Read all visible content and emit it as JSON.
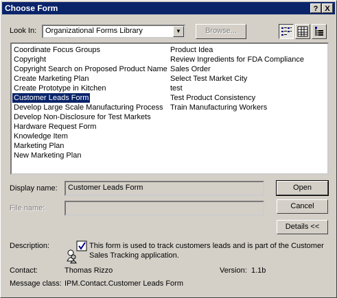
{
  "window": {
    "title": "Choose Form",
    "help_btn": "?",
    "close_btn": "X"
  },
  "lookin": {
    "label": "Look In:",
    "value": "Organizational Forms Library",
    "browse_label": "Browse..."
  },
  "forms": {
    "col1": [
      "Coordinate Focus Groups",
      "Copyright",
      "Copyright Search on Proposed Product Name",
      "Create Marketing Plan",
      "Create Prototype in Kitchen",
      "Customer Leads Form",
      "Develop Large Scale Manufacturing Process",
      "Develop Non-Disclosure for Test Markets",
      "Hardware Request Form",
      "Knowledge Item",
      "Marketing Plan",
      "New Marketing Plan"
    ],
    "col2": [
      "Product Idea",
      "Review Ingredients for FDA Compliance",
      "Sales Order",
      "Select Test Market City",
      "test",
      "Test Product Consistency",
      "Train Manufacturing Workers"
    ],
    "selected": "Customer Leads Form"
  },
  "display_name": {
    "label": "Display name:",
    "value": "Customer Leads Form"
  },
  "file_name": {
    "label": "File name:",
    "value": ""
  },
  "buttons": {
    "open": "Open",
    "cancel": "Cancel",
    "details": "Details <<"
  },
  "details": {
    "description_label": "Description:",
    "description_text_1": "This form is used to track customers leads and is part of the Customer",
    "description_text_2": "Sales Tracking application.",
    "contact_label": "Contact:",
    "contact_value": "Thomas Rizzo",
    "version_label": "Version:",
    "version_value": "1.1b",
    "message_class_label": "Message class:",
    "message_class_value": "IPM.Contact.Customer Leads Form"
  },
  "colors": {
    "titlebar": "#0a246a",
    "selection": "#0a246a",
    "face": "#d4d0c8"
  }
}
